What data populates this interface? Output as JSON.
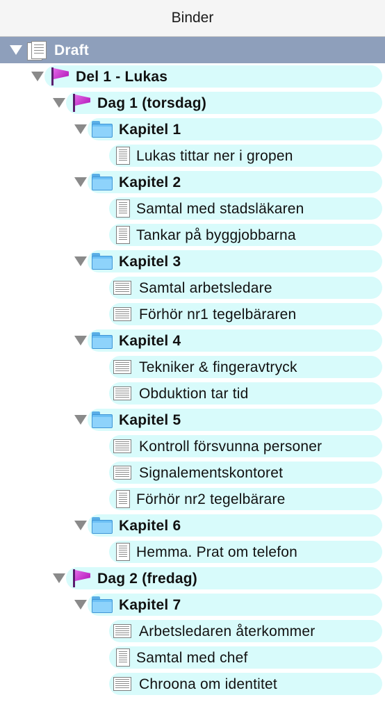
{
  "header": {
    "title": "Binder"
  },
  "tree": [
    {
      "label": "Draft",
      "type": "draft",
      "level": 0,
      "disclosure": true,
      "selected": true,
      "bold": true
    },
    {
      "label": "Del 1 - Lukas",
      "type": "flag",
      "level": 1,
      "disclosure": true,
      "bold": true
    },
    {
      "label": "Dag 1 (torsdag)",
      "type": "flag",
      "level": 2,
      "disclosure": true,
      "bold": true
    },
    {
      "label": "Kapitel 1",
      "type": "folder",
      "level": 3,
      "disclosure": true,
      "bold": true
    },
    {
      "label": "Lukas tittar ner i gropen",
      "type": "doc-v",
      "level": 4
    },
    {
      "label": "Kapitel 2",
      "type": "folder",
      "level": 3,
      "disclosure": true,
      "bold": true
    },
    {
      "label": "Samtal med stadsläkaren",
      "type": "doc-v",
      "level": 4
    },
    {
      "label": "Tankar på byggjobbarna",
      "type": "doc-v",
      "level": 4
    },
    {
      "label": "Kapitel 3",
      "type": "folder",
      "level": 3,
      "disclosure": true,
      "bold": true
    },
    {
      "label": "Samtal arbetsledare",
      "type": "doc-h",
      "level": 4
    },
    {
      "label": "Förhör nr1 tegelbäraren",
      "type": "doc-h",
      "level": 4
    },
    {
      "label": "Kapitel 4",
      "type": "folder",
      "level": 3,
      "disclosure": true,
      "bold": true
    },
    {
      "label": "Tekniker & fingeravtryck",
      "type": "doc-h",
      "level": 4
    },
    {
      "label": "Obduktion tar tid",
      "type": "doc-h",
      "level": 4
    },
    {
      "label": "Kapitel 5",
      "type": "folder",
      "level": 3,
      "disclosure": true,
      "bold": true
    },
    {
      "label": "Kontroll försvunna personer",
      "type": "doc-h",
      "level": 4
    },
    {
      "label": "Signalementskontoret",
      "type": "doc-h",
      "level": 4
    },
    {
      "label": "Förhör nr2 tegelbärare",
      "type": "doc-v",
      "level": 4
    },
    {
      "label": "Kapitel 6",
      "type": "folder",
      "level": 3,
      "disclosure": true,
      "bold": true
    },
    {
      "label": "Hemma. Prat om telefon",
      "type": "doc-v",
      "level": 4
    },
    {
      "label": "Dag 2 (fredag)",
      "type": "flag",
      "level": 2,
      "disclosure": true,
      "bold": true
    },
    {
      "label": "Kapitel 7",
      "type": "folder",
      "level": 3,
      "disclosure": true,
      "bold": true
    },
    {
      "label": "Arbetsledaren återkommer",
      "type": "doc-h",
      "level": 4
    },
    {
      "label": "Samtal med chef",
      "type": "doc-v",
      "level": 4
    },
    {
      "label": "Chroona om identitet",
      "type": "doc-h",
      "level": 4
    }
  ]
}
